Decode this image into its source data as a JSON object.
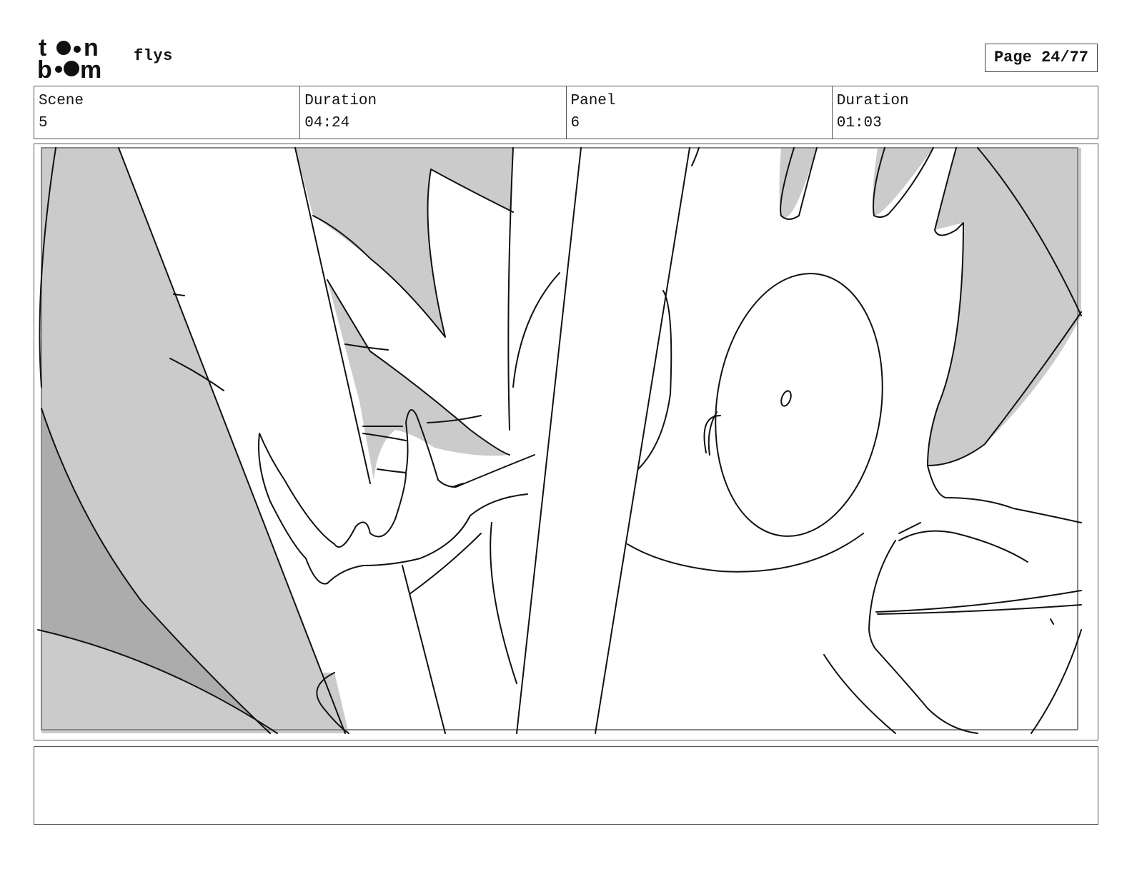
{
  "header": {
    "logo_text": "toonboom",
    "project_title": "flys",
    "page_label": "Page 24/77"
  },
  "info": [
    {
      "label": "Scene",
      "value": "5"
    },
    {
      "label": "Duration",
      "value": "04:24"
    },
    {
      "label": "Panel",
      "value": "6"
    },
    {
      "label": "Duration",
      "value": "01:03"
    }
  ],
  "notes": {
    "text": ""
  },
  "colors": {
    "light_gray": "#cbcbcb",
    "dark_gray": "#acacac",
    "line": "#111111"
  }
}
